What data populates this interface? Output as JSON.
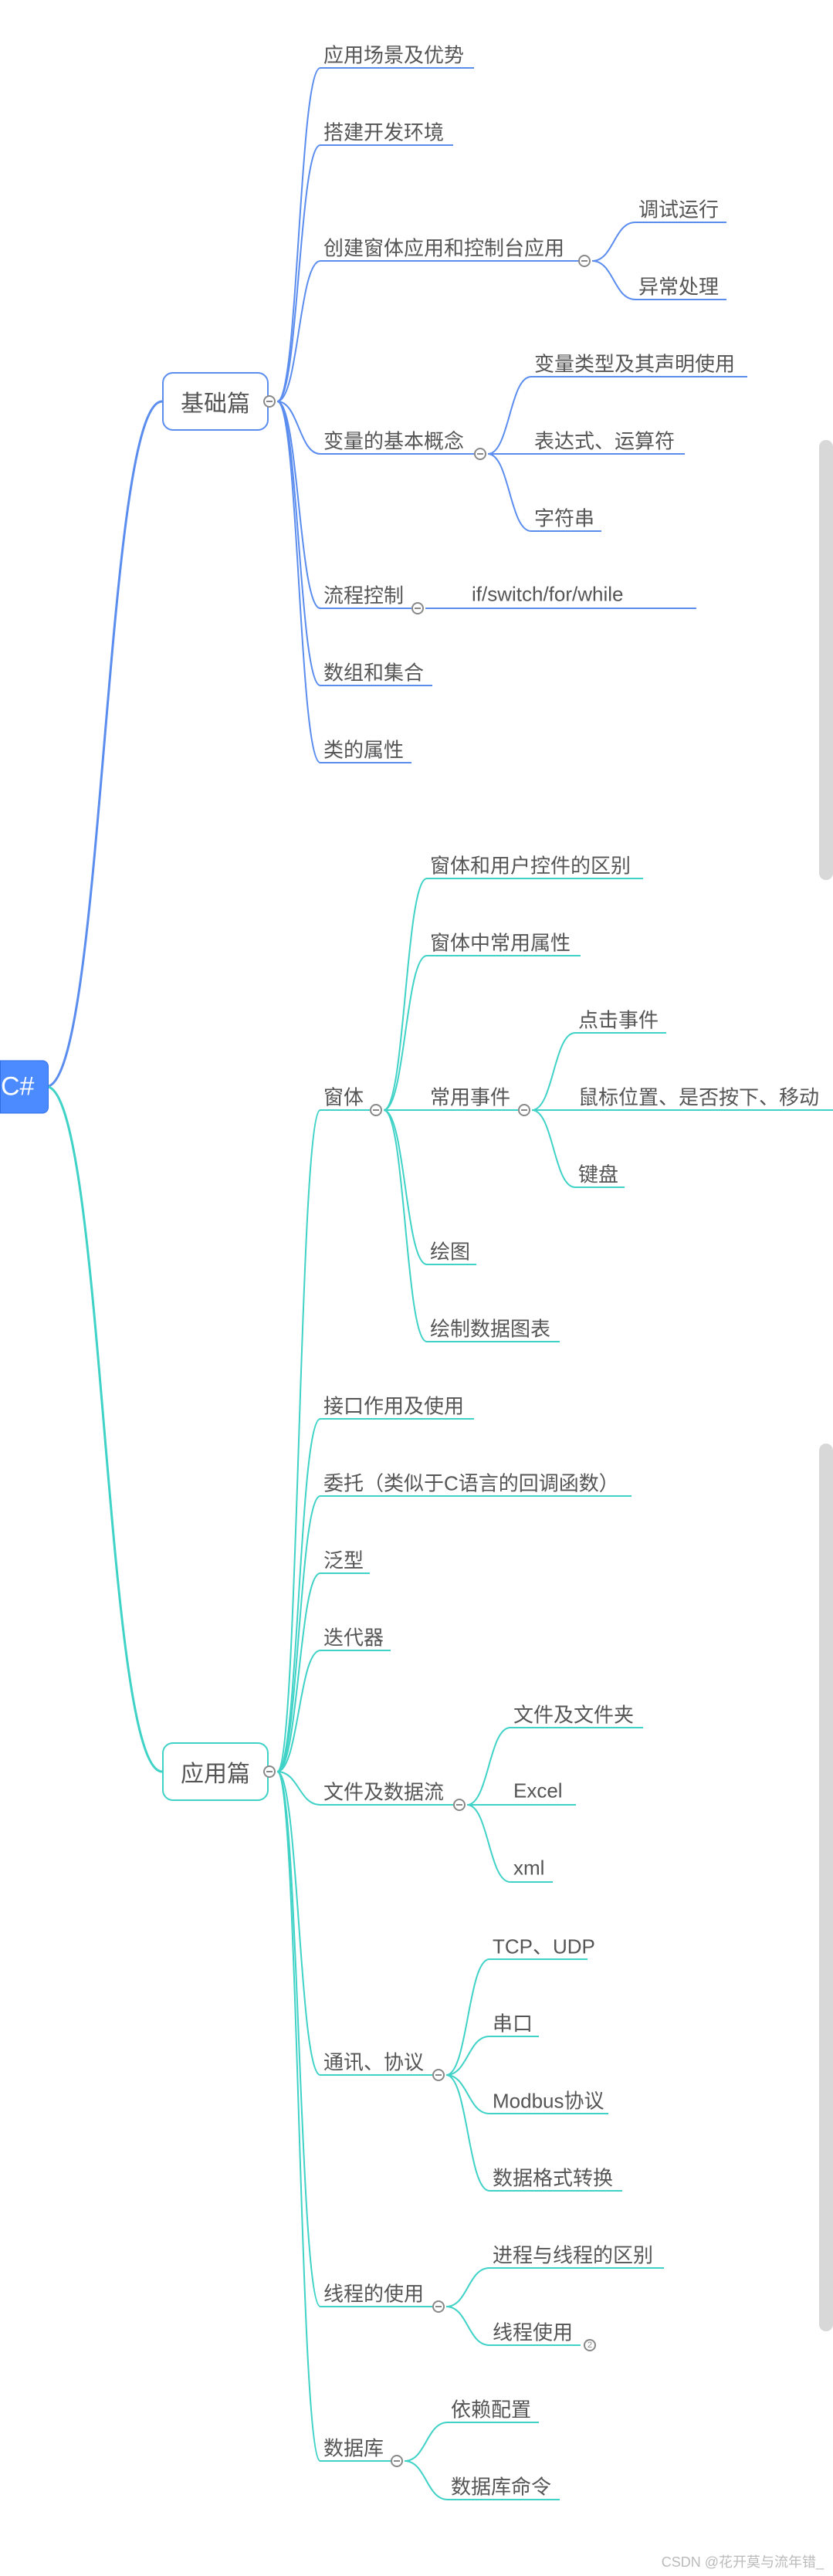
{
  "root": "C#",
  "watermark": "CSDN @花开莫与流年错_",
  "tree": [
    {
      "label": "基础篇",
      "color": "#5b8def",
      "class": "main blue",
      "children": [
        {
          "label": "应用场景及优势"
        },
        {
          "label": "搭建开发环境"
        },
        {
          "label": "创建窗体应用和控制台应用",
          "children": [
            {
              "label": "调试运行"
            },
            {
              "label": "异常处理"
            }
          ]
        },
        {
          "label": "变量的基本概念",
          "children": [
            {
              "label": "变量类型及其声明使用"
            },
            {
              "label": "表达式、运算符"
            },
            {
              "label": "字符串"
            }
          ]
        },
        {
          "label": "流程控制",
          "children": [
            {
              "label": "if/switch/for/while"
            }
          ]
        },
        {
          "label": "数组和集合"
        },
        {
          "label": "类的属性"
        }
      ]
    },
    {
      "label": "应用篇",
      "color": "#3fd2c7",
      "class": "main teal",
      "children": [
        {
          "label": "窗体",
          "children": [
            {
              "label": "窗体和用户控件的区别"
            },
            {
              "label": "窗体中常用属性"
            },
            {
              "label": "常用事件",
              "children": [
                {
                  "label": "点击事件"
                },
                {
                  "label": "鼠标位置、是否按下、移动"
                },
                {
                  "label": "键盘"
                }
              ]
            },
            {
              "label": "绘图"
            },
            {
              "label": "绘制数据图表"
            }
          ]
        },
        {
          "label": "接口作用及使用"
        },
        {
          "label": "委托（类似于C语言的回调函数）"
        },
        {
          "label": "泛型"
        },
        {
          "label": "迭代器"
        },
        {
          "label": "文件及数据流",
          "children": [
            {
              "label": "文件及文件夹"
            },
            {
              "label": "Excel"
            },
            {
              "label": "xml"
            }
          ]
        },
        {
          "label": "通讯、协议",
          "children": [
            {
              "label": "TCP、UDP"
            },
            {
              "label": "串口"
            },
            {
              "label": "Modbus协议"
            },
            {
              "label": "数据格式转换"
            }
          ]
        },
        {
          "label": "线程的使用",
          "children": [
            {
              "label": "进程与线程的区别"
            },
            {
              "label": "线程使用",
              "badge": "2"
            }
          ]
        },
        {
          "label": "数据库",
          "children": [
            {
              "label": "依赖配置"
            },
            {
              "label": "数据库命令"
            }
          ]
        }
      ]
    }
  ]
}
